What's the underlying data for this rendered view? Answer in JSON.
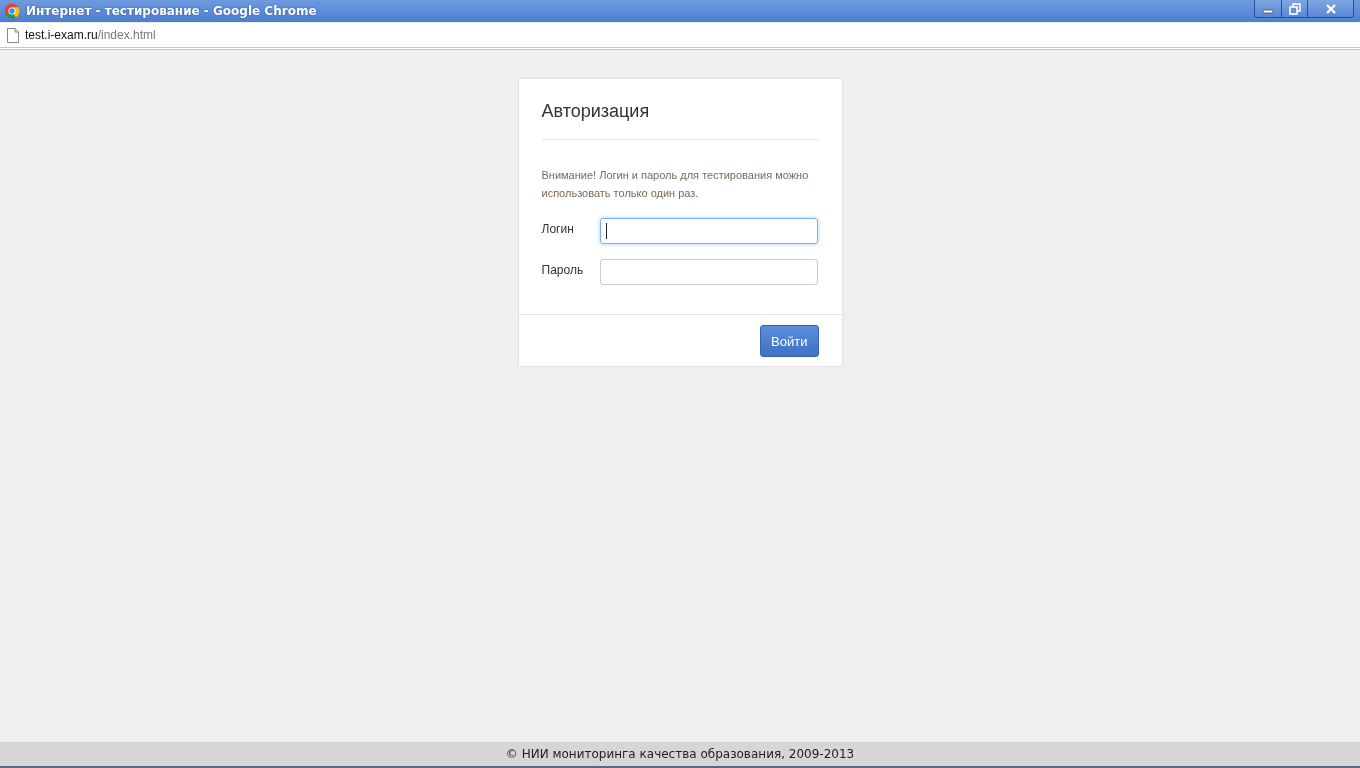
{
  "window": {
    "title": "Интернет - тестирование - Google Chrome"
  },
  "address_bar": {
    "host": "test.i-exam.ru",
    "path": "/index.html"
  },
  "login_panel": {
    "title": "Авторизация",
    "notice": "Внимание! Логин и пароль для тестирования можно использовать только один раз.",
    "fields": [
      {
        "label": "Логин",
        "focused": true
      },
      {
        "label": "Пароль",
        "focused": false
      }
    ],
    "button": "Войти"
  },
  "footer": "© НИИ мониторинга качества образования, 2009-2013"
}
